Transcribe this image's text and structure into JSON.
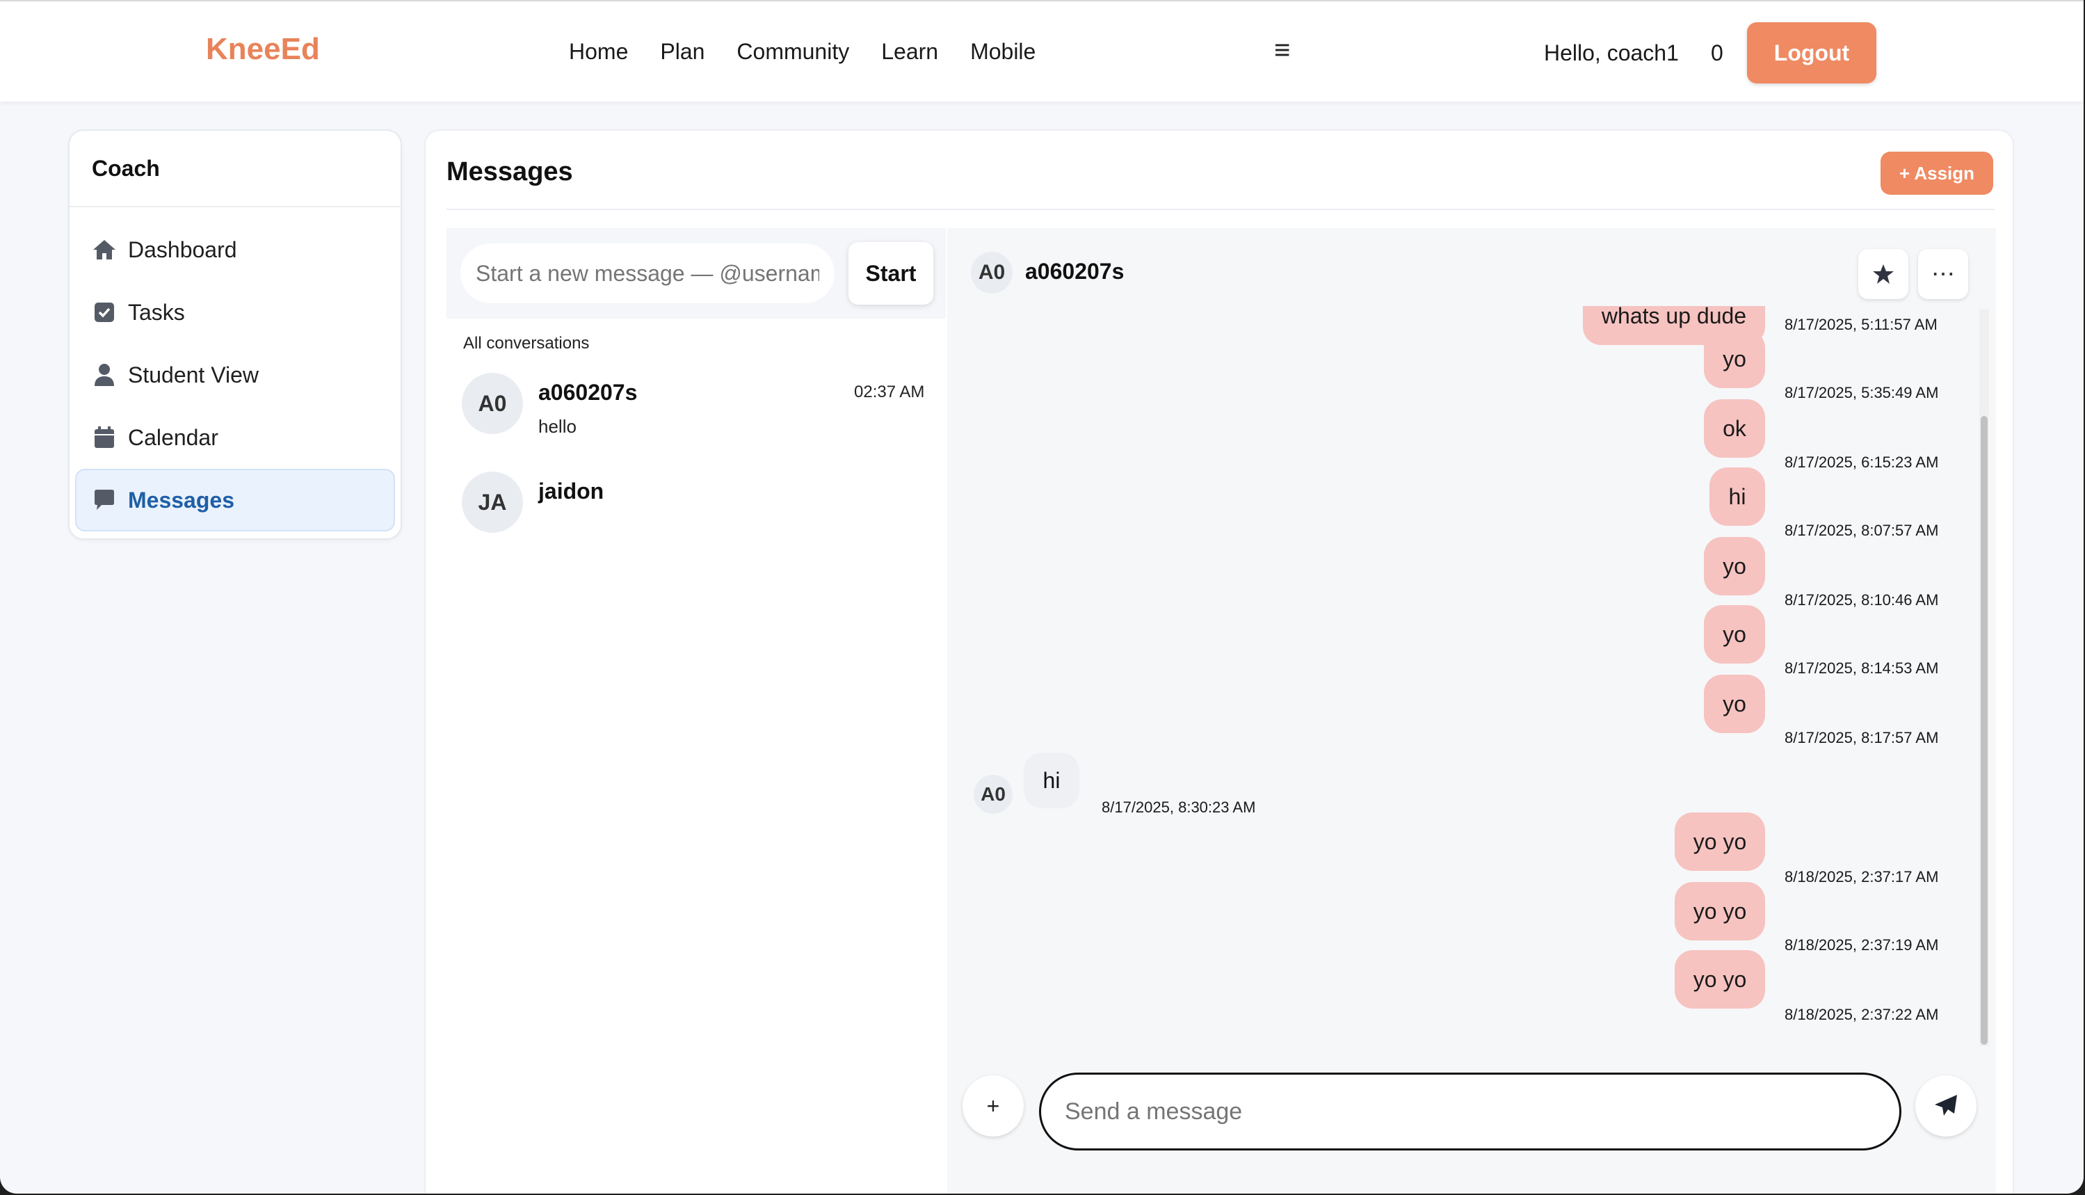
{
  "header": {
    "brand": "KneeEd",
    "nav": [
      "Home",
      "Plan",
      "Community",
      "Learn",
      "Mobile"
    ],
    "menu_icon": "hamburger-icon",
    "greeting": "Hello, coach1",
    "notification_count": "0",
    "logout_label": "Logout"
  },
  "sidebar": {
    "title": "Coach",
    "items": [
      {
        "label": "Dashboard",
        "icon": "home-icon"
      },
      {
        "label": "Tasks",
        "icon": "checkbox-icon"
      },
      {
        "label": "Student View",
        "icon": "user-icon"
      },
      {
        "label": "Calendar",
        "icon": "calendar-icon"
      },
      {
        "label": "Messages",
        "icon": "chat-icon",
        "active": true
      }
    ]
  },
  "main": {
    "title": "Messages",
    "assign_label": "+ Assign"
  },
  "conversations": {
    "new_message_placeholder": "Start a new message — @username",
    "start_label": "Start",
    "section_label": "All conversations",
    "items": [
      {
        "initials": "A0",
        "name": "a060207s",
        "preview": "hello",
        "time": "02:37 AM"
      },
      {
        "initials": "JA",
        "name": "jaidon",
        "preview": "",
        "time": ""
      }
    ]
  },
  "chat": {
    "initials": "A0",
    "name": "a060207s",
    "star_icon": "star-icon",
    "more_icon": "more-icon",
    "messages": [
      {
        "text": "whats up dude",
        "time": "8/17/2025, 5:11:57 AM",
        "out": true
      },
      {
        "text": "yo",
        "time": "8/17/2025, 5:35:49 AM",
        "out": true
      },
      {
        "text": "ok",
        "time": "8/17/2025, 6:15:23 AM",
        "out": true
      },
      {
        "text": "hi",
        "time": "8/17/2025, 8:07:57 AM",
        "out": true
      },
      {
        "text": "yo",
        "time": "8/17/2025, 8:10:46 AM",
        "out": true
      },
      {
        "text": "yo",
        "time": "8/17/2025, 8:14:53 AM",
        "out": true
      },
      {
        "text": "yo",
        "time": "8/17/2025, 8:17:57 AM",
        "out": true
      },
      {
        "text": "hi",
        "time": "8/17/2025, 8:30:23 AM",
        "out": false,
        "initials": "A0"
      },
      {
        "text": "yo yo",
        "time": "8/18/2025, 2:37:17 AM",
        "out": true
      },
      {
        "text": "yo yo",
        "time": "8/18/2025, 2:37:19 AM",
        "out": true
      },
      {
        "text": "yo yo",
        "time": "8/18/2025, 2:37:22 AM",
        "out": true
      }
    ],
    "composer_placeholder": "Send a message",
    "attach_icon": "plus-icon",
    "send_icon": "send-icon"
  },
  "colors": {
    "brand": "#e8835a",
    "accent_button": "#ef8a62",
    "outgoing_bubble": "#f6c3c0",
    "active_nav": "#1f5fa6"
  }
}
